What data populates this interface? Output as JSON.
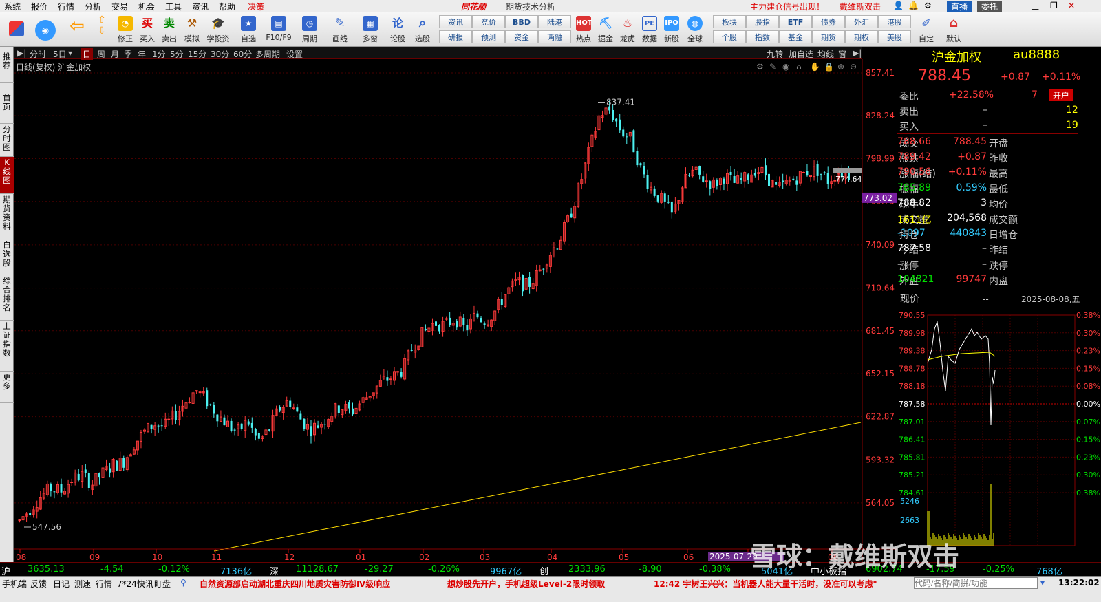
{
  "menu": [
    "系统",
    "报价",
    "行情",
    "分析",
    "交易",
    "机会",
    "工具",
    "资讯",
    "帮助",
    "决策"
  ],
  "app_logo": "同花顺",
  "app_title": "期货技术分析",
  "promo": "主力建仓信号出现！",
  "brand": "戴维斯双击",
  "btn_live": "直播",
  "btn_entrust": "委托",
  "toolbar": {
    "big_buttons": [
      "修正",
      "买入",
      "卖出",
      "模拟",
      "学投资",
      "自选",
      "F10/F9",
      "周期",
      "画线",
      "多窗",
      "论股",
      "选股"
    ],
    "small_col1": [
      "资讯",
      "研报"
    ],
    "small_col2": [
      "竞价",
      "预测"
    ],
    "small_col3": [
      "BBD",
      "资金"
    ],
    "small_col4": [
      "陆港",
      "两融"
    ],
    "icon_buttons": [
      "热点",
      "掘金",
      "龙虎",
      "数据",
      "新股",
      "全球"
    ],
    "small_col5": [
      "板块",
      "个股"
    ],
    "small_col6": [
      "股指",
      "指数"
    ],
    "small_col7": [
      "ETF",
      "基金"
    ],
    "small_col8": [
      "债券",
      "期货"
    ],
    "small_col9": [
      "外汇",
      "期权"
    ],
    "small_col10": [
      "港股",
      "美股"
    ],
    "end_buttons": [
      "自定",
      "默认"
    ]
  },
  "leftnav": [
    "推荐",
    "首页",
    "分时图",
    "K线图",
    "期货资料",
    "自选股",
    "综合排名",
    "上证指数",
    "更多"
  ],
  "periods": [
    "分时",
    "5日",
    "日",
    "周",
    "月",
    "季",
    "年",
    "1分",
    "5分",
    "15分",
    "30分",
    "60分",
    "多周期",
    "设置"
  ],
  "period_right": [
    "九转",
    "加自选",
    "均线",
    "窗"
  ],
  "chart_title": "日线(复权)  沪金加权",
  "chart_data": {
    "type": "candlestick",
    "ylim": [
      547.56,
      857.41
    ],
    "yticks": [
      857.41,
      828.24,
      798.99,
      769.75,
      740.09,
      710.64,
      681.45,
      652.15,
      622.87,
      593.32,
      564.05
    ],
    "xticks": [
      "08",
      "09",
      "10",
      "11",
      "12",
      "01",
      "02",
      "03",
      "04",
      "05",
      "06",
      "07",
      "08"
    ],
    "annot_high": "837.41",
    "annot_low": "547.56",
    "last_label": "773.02",
    "last_low": "774.64",
    "date_label": "2025-07-29",
    "close_series": [
      552,
      560,
      568,
      574,
      572,
      580,
      583,
      577,
      584,
      590,
      592,
      604,
      612,
      618,
      616,
      624,
      633,
      641,
      634,
      625,
      618,
      612,
      620,
      606,
      613,
      628,
      634,
      622,
      614,
      618,
      625,
      630,
      626,
      633,
      640,
      647,
      650,
      655,
      672,
      680,
      687,
      685,
      690,
      682,
      692,
      688,
      696,
      708,
      715,
      712,
      720,
      733,
      742,
      758,
      780,
      805,
      830,
      832,
      818,
      812,
      790,
      778,
      770,
      760,
      782,
      790,
      785,
      781,
      787,
      782,
      785,
      792,
      788,
      778,
      782,
      786,
      790,
      791,
      784,
      790,
      788
    ]
  },
  "quote": {
    "name": "沪金加权",
    "code": "au8888",
    "price": "788.45",
    "change": "+0.87",
    "pct": "+0.11%",
    "weibi_label": "委比",
    "weibi": "+22.58%",
    "weicha": "7",
    "open_btn": "开户",
    "rows": [
      {
        "l": "卖出",
        "v": "–",
        "v2": "12"
      },
      {
        "l": "买入",
        "v": "–",
        "v2": "19"
      }
    ],
    "pairs": [
      {
        "l1": "成交",
        "v1": "788.45",
        "l2": "开盘",
        "v2": "788.66"
      },
      {
        "l1": "涨跌",
        "v1": "+0.87",
        "l2": "昨收",
        "v2": "789.42"
      },
      {
        "l1": "涨幅(结)",
        "v1": "+0.11%",
        "l2": "最高",
        "v2": "790.56"
      },
      {
        "l1": "振幅",
        "v1": "0.59%",
        "l2": "最低",
        "v2": "785.89"
      },
      {
        "l1": "现手",
        "v1": "3",
        "l2": "均价",
        "v2": "788.82"
      },
      {
        "l1": "成交量",
        "v1": "204,568",
        "l2": "成交额",
        "v2": "1611亿"
      },
      {
        "l1": "持仓",
        "v1": "440843",
        "l2": "日增仓",
        "v2": "-1097"
      },
      {
        "l1": "今结",
        "v1": "–",
        "l2": "昨结",
        "v2": "787.58"
      },
      {
        "l1": "涨停",
        "v1": "–",
        "l2": "跌停",
        "v2": "–"
      },
      {
        "l1": "外盘",
        "v1": "99747",
        "l2": "内盘",
        "v2": "104821"
      }
    ],
    "mini_label": "现价",
    "mini_dash": "--",
    "mini_date": "2025-08-08,五",
    "mini_prices": [
      "790.55",
      "789.98",
      "789.38",
      "788.78",
      "788.18",
      "787.58",
      "787.01",
      "786.41",
      "785.81",
      "785.21",
      "784.61"
    ],
    "mini_pcts": [
      "0.38%",
      "0.30%",
      "0.23%",
      "0.15%",
      "0.08%",
      "0.00%",
      "0.07%",
      "0.15%",
      "0.23%",
      "0.30%",
      "0.38%"
    ],
    "mini_vol": [
      "5246",
      "2663"
    ]
  },
  "indices": {
    "sh_label": "沪",
    "sh": "3635.13",
    "sh_chg": "-4.54",
    "sh_pct": "-0.12%",
    "sh_amt": "7136亿",
    "sz_label": "深",
    "sz": "11128.67",
    "sz_chg": "-29.27",
    "sz_pct": "-0.26%",
    "sz_amt": "9967亿",
    "cy_label": "创",
    "cy": "2333.96",
    "cy_chg": "-8.90",
    "cy_pct": "-0.38%",
    "cy_amt": "5041亿",
    "zx_label": "中小板指",
    "zx": "6902.74",
    "zx_chg": "-17.59",
    "zx_pct": "-0.25%",
    "zx_amt": "768亿"
  },
  "status": {
    "left": [
      "手机端",
      "反馈",
      "日记",
      "测速",
      "行情",
      "7*24快讯",
      "盯盘"
    ],
    "news1": "自然资源部启动湖北重庆四川地质灾害防御Ⅳ级响应",
    "news2": "想炒股先开户，手机超级Level-2限时领取",
    "news3": "12:42 宇树王兴兴：当机器人能大量干活时，没准可以考虑\"",
    "search_ph": "代码/名称/简拼/功能",
    "time": "13:22:02"
  },
  "watermark": "雪球：戴维斯双击"
}
